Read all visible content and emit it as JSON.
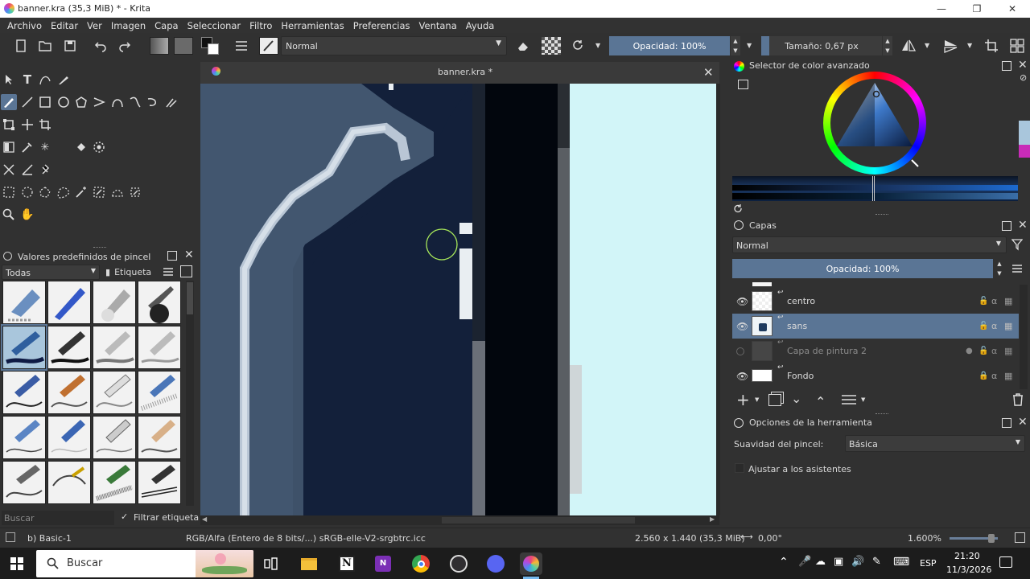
{
  "window": {
    "title": "banner.kra (35,3 MiB)  * - Krita"
  },
  "menu": [
    "Archivo",
    "Editar",
    "Ver",
    "Imagen",
    "Capa",
    "Seleccionar",
    "Filtro",
    "Herramientas",
    "Preferencias",
    "Ventana",
    "Ayuda"
  ],
  "toolbar": {
    "blend_mode": "Normal",
    "opacity": "Opacidad: 100%",
    "size": "Tamaño: 0,67 px"
  },
  "brush_presets": {
    "title": "Valores predefinidos de pincel",
    "filter_value": "Todas",
    "tag_label": "Etiqueta",
    "search_placeholder": "Buscar",
    "filter_tag_label": "Filtrar etiqueta"
  },
  "document": {
    "tab_title": "banner.kra *"
  },
  "color_selector": {
    "title": "Selector de color avanzado"
  },
  "layers": {
    "title": "Capas",
    "blend_mode": "Normal",
    "opacity": "Opacidad:  100%",
    "items": [
      {
        "name": "centro",
        "visible": true,
        "selected": false
      },
      {
        "name": "sans",
        "visible": true,
        "selected": true
      },
      {
        "name": "Capa de pintura 2",
        "visible": false,
        "selected": false
      },
      {
        "name": "Fondo",
        "visible": true,
        "selected": false
      }
    ]
  },
  "tool_options": {
    "title": "Opciones de la herramienta",
    "smoothing_label": "Suavidad del pincel:",
    "smoothing_value": "Básica",
    "assistants_label": "Ajustar a los asistentes"
  },
  "status": {
    "preset": "b) Basic-1",
    "colorspace": "RGB/Alfa (Entero de 8 bits/...)  sRGB-elle-V2-srgbtrc.icc",
    "dimensions": "2.560 x 1.440 (35,3 MiB)",
    "rotation": "0,00°",
    "zoom": "1.600%"
  },
  "taskbar": {
    "search_placeholder": "Buscar",
    "time": "21:20",
    "date": "11/3/2026",
    "language": "ESP"
  },
  "colors": {
    "accent": "#5a7595",
    "panel": "#313131",
    "canvas_dark": "#13203a",
    "canvas_light": "#d2f5f8"
  }
}
